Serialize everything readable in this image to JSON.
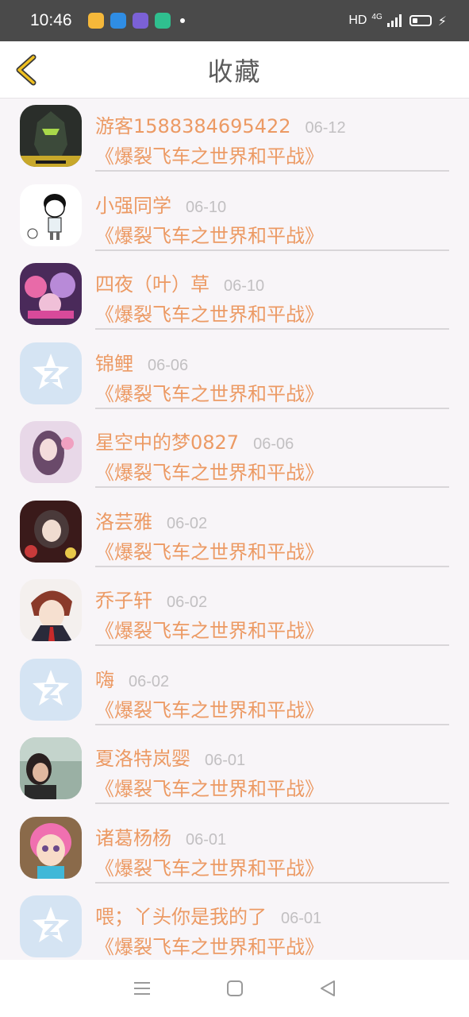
{
  "status_bar": {
    "time": "10:46",
    "network": "HD",
    "signal": "4G",
    "app_icons": [
      "#f5b83a",
      "#2f8de4",
      "#7b61d6",
      "#2fbf8f"
    ]
  },
  "header": {
    "title": "收藏",
    "back_icon": "chevron-left-icon",
    "accent_color": "#f0c020"
  },
  "favorites": [
    {
      "user": "游客1588384695422",
      "date": "06-12",
      "game": "《爆裂飞车之世界和平战》",
      "avatar": "armor"
    },
    {
      "user": "小强同学",
      "date": "06-10",
      "game": "《爆裂飞车之世界和平战》",
      "avatar": "cartoon"
    },
    {
      "user": "四夜（叶）草",
      "date": "06-10",
      "game": "《爆裂飞车之世界和平战》",
      "avatar": "colorful"
    },
    {
      "user": "锦鲤",
      "date": "06-06",
      "game": "《爆裂飞车之世界和平战》",
      "avatar": "default"
    },
    {
      "user": "星空中的梦0827",
      "date": "06-06",
      "game": "《爆裂飞车之世界和平战》",
      "avatar": "girl-pink"
    },
    {
      "user": "洛芸雅",
      "date": "06-02",
      "game": "《爆裂飞车之世界和平战》",
      "avatar": "anime-dark"
    },
    {
      "user": "乔子轩",
      "date": "06-02",
      "game": "《爆裂飞车之世界和平战》",
      "avatar": "anime-boy"
    },
    {
      "user": "嗨",
      "date": "06-02",
      "game": "《爆裂飞车之世界和平战》",
      "avatar": "default"
    },
    {
      "user": "夏洛特岚婴",
      "date": "06-01",
      "game": "《爆裂飞车之世界和平战》",
      "avatar": "photo"
    },
    {
      "user": "诸葛杨杨",
      "date": "06-01",
      "game": "《爆裂飞车之世界和平战》",
      "avatar": "doll"
    },
    {
      "user": "喂；丫头你是我的了",
      "date": "06-01",
      "game": "《爆裂飞车之世界和平战》",
      "avatar": "default"
    }
  ],
  "colors": {
    "name_orange": "#ec9a64",
    "date_gray": "#c2c0c2",
    "background": "#f8f5f8"
  },
  "nav_bar": [
    "menu-icon",
    "home-icon",
    "back-triangle-icon"
  ]
}
